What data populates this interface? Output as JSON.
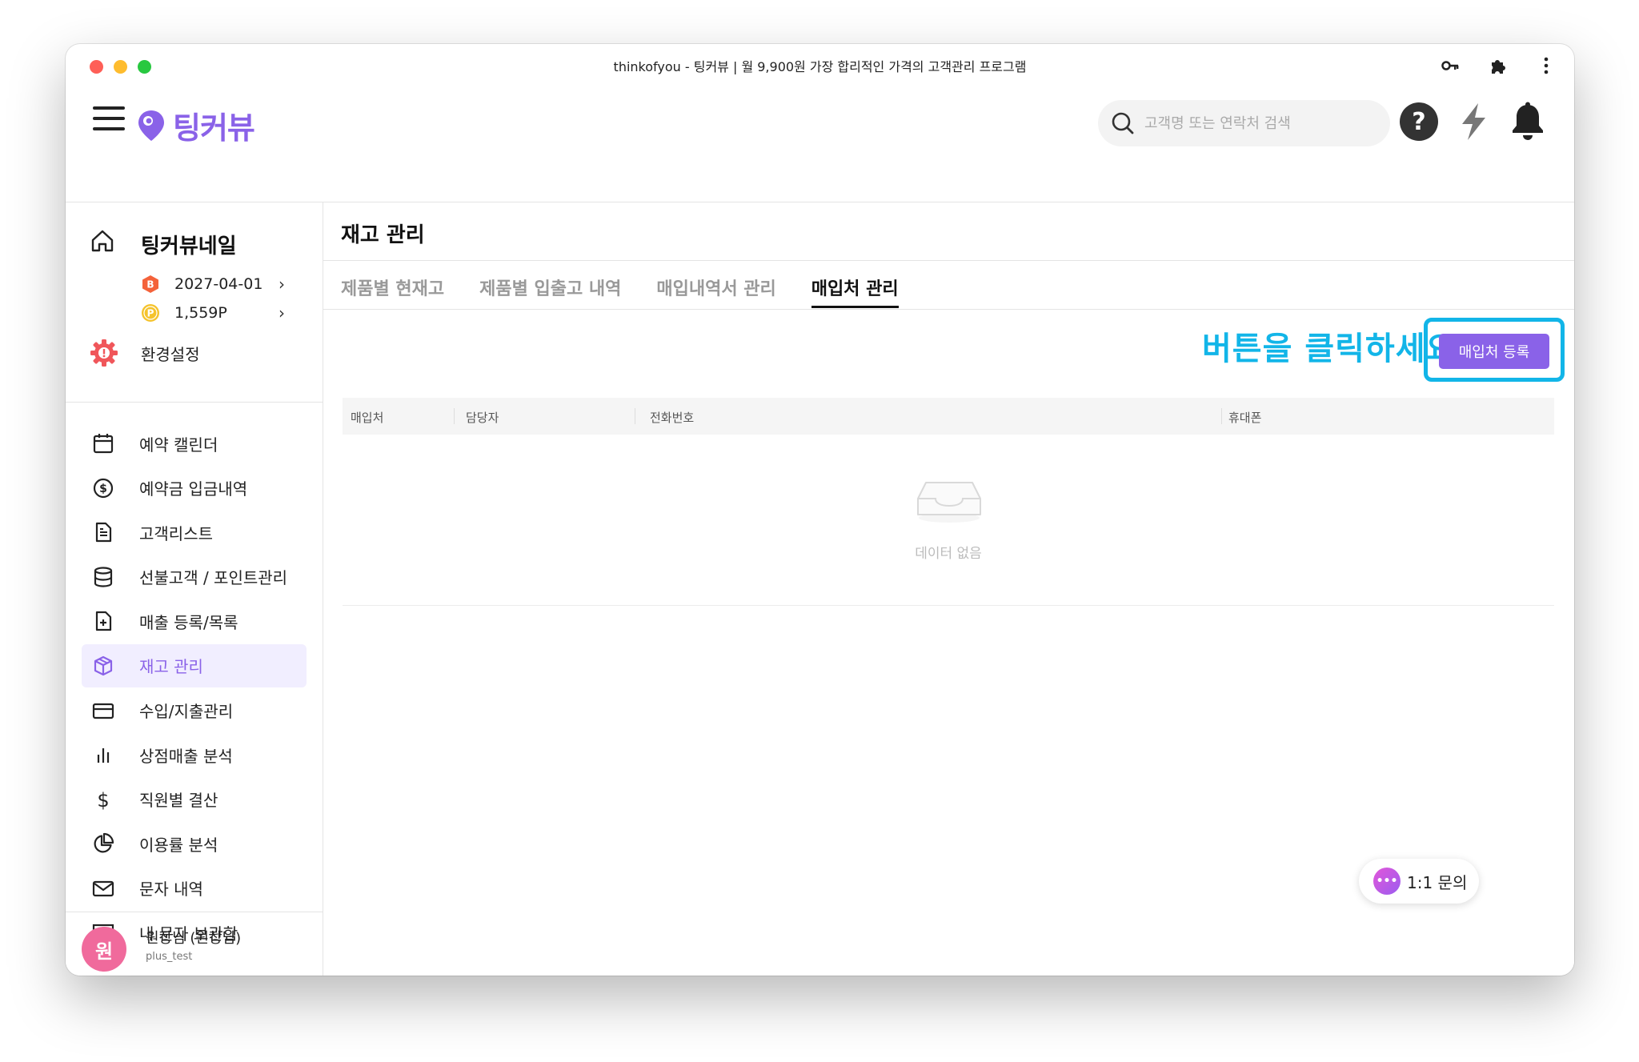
{
  "window": {
    "title": "thinkofyou - 팅커뷰 | 월 9,900원 가장 합리적인 가격의 고객관리 프로그램"
  },
  "header": {
    "logo_text": "팅커뷰",
    "search_placeholder": "고객명 또는 연락처 검색",
    "icons": [
      "menu-icon",
      "search-icon",
      "help-icon",
      "lightning-icon",
      "bell-icon"
    ]
  },
  "sidebar": {
    "shop_name": "팅커뷰네일",
    "expiry_badge": "B",
    "expiry_date": "2027-04-01",
    "points_badge": "P",
    "points": "1,559P",
    "chevron": "›",
    "settings_label": "환경설정",
    "items": [
      {
        "label": "예약 캘린더",
        "icon": "calendar-icon"
      },
      {
        "label": "예약금 입금내역",
        "icon": "dollar-circle-icon"
      },
      {
        "label": "고객리스트",
        "icon": "document-icon"
      },
      {
        "label": "선불고객 / 포인트관리",
        "icon": "database-icon"
      },
      {
        "label": "매출 등록/목록",
        "icon": "file-plus-icon"
      },
      {
        "label": "재고 관리",
        "icon": "box-icon",
        "active": true
      },
      {
        "label": "수입/지출관리",
        "icon": "credit-card-icon"
      },
      {
        "label": "상점매출 분석",
        "icon": "bar-chart-icon"
      },
      {
        "label": "직원별 결산",
        "icon": "dollar-icon"
      },
      {
        "label": "이용률 분석",
        "icon": "pie-chart-icon"
      },
      {
        "label": "문자 내역",
        "icon": "mail-icon"
      },
      {
        "label": "내 문자 보관함",
        "icon": "archive-icon"
      }
    ],
    "profile": {
      "avatar_text": "원",
      "name": "원장님 (원장님)",
      "id": "plus_test"
    }
  },
  "main": {
    "page_title": "재고 관리",
    "tabs": [
      {
        "label": "제품별 현재고"
      },
      {
        "label": "제품별 입출고 내역"
      },
      {
        "label": "매입내역서 관리"
      },
      {
        "label": "매입처 관리",
        "active": true
      }
    ],
    "hint_text": "버튼을 클릭하세요",
    "register_button": "매입처 등록",
    "table": {
      "columns": [
        "매입처",
        "담당자",
        "전화번호",
        "휴대폰"
      ],
      "empty_text": "데이터 없음"
    }
  },
  "chat": {
    "label": "1:1 문의",
    "icon_text": "•••"
  },
  "colors": {
    "accent": "#8a62e8",
    "hint": "#12b5e8",
    "active_bg": "#f1eeff"
  }
}
